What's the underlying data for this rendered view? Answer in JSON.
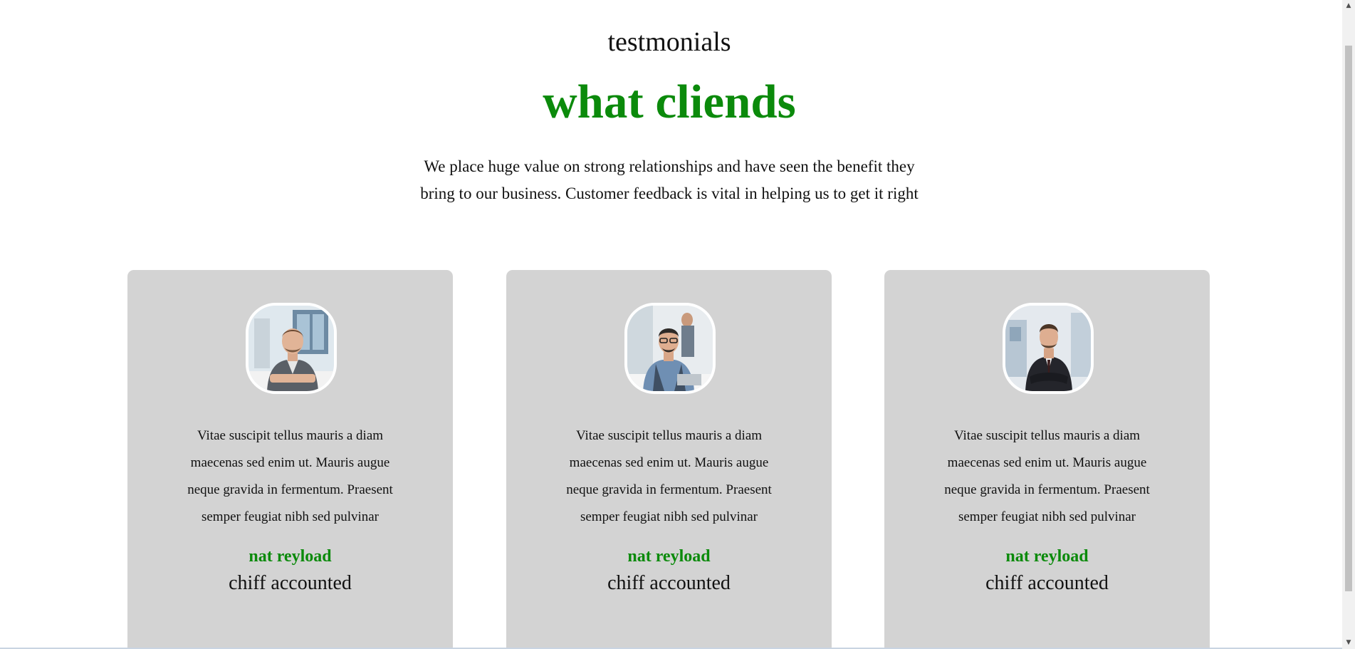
{
  "section": {
    "eyebrow": "testmonials",
    "headline": "what cliends",
    "intro": "We place huge value on strong relationships and have seen the benefit they bring to our business. Customer feedback is vital in helping us to get it right"
  },
  "colors": {
    "accent": "#0b8a0b",
    "card_background": "#d3d3d3"
  },
  "testimonials": [
    {
      "quote": "Vitae suscipit tellus mauris a diam maecenas sed enim ut. Mauris augue neque gravida in fermentum. Praesent semper feugiat nibh sed pulvinar",
      "name": "nat reyload",
      "role": "chiff accounted"
    },
    {
      "quote": "Vitae suscipit tellus mauris a diam maecenas sed enim ut. Mauris augue neque gravida in fermentum. Praesent semper feugiat nibh sed pulvinar",
      "name": "nat reyload",
      "role": "chiff accounted"
    },
    {
      "quote": "Vitae suscipit tellus mauris a diam maecenas sed enim ut. Mauris augue neque gravida in fermentum. Praesent semper feugiat nibh sed pulvinar",
      "name": "nat reyload",
      "role": "chiff accounted"
    }
  ],
  "scrollbar": {
    "up_icon": "scroll-up-arrow-icon",
    "down_icon": "scroll-down-arrow-icon"
  }
}
